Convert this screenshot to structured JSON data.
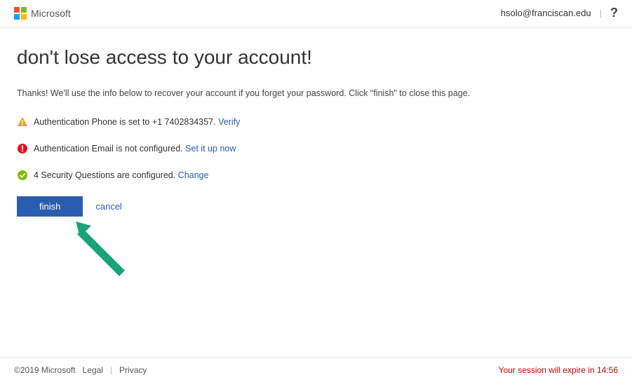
{
  "header": {
    "brand": "Microsoft",
    "user_email": "hsolo@franciscan.edu",
    "help_glyph": "?"
  },
  "page": {
    "title": "don't lose access to your account!",
    "intro": "Thanks! We'll use the info below to recover your account if you forget your password. Click \"finish\" to close this page."
  },
  "rows": {
    "phone": {
      "text_prefix": "Authentication Phone is set to ",
      "value": "+1 7402834357",
      "period": ". ",
      "action_label": "Verify"
    },
    "email": {
      "text": "Authentication Email is not configured. ",
      "action_label": "Set it up now"
    },
    "questions": {
      "text": "4 Security Questions are configured. ",
      "action_label": "Change"
    }
  },
  "actions": {
    "finish": "finish",
    "cancel": "cancel"
  },
  "footer": {
    "copyright": "©2019 Microsoft",
    "legal": "Legal",
    "privacy": "Privacy",
    "session_prefix": "Your session will expire in ",
    "session_time": "14:56"
  }
}
